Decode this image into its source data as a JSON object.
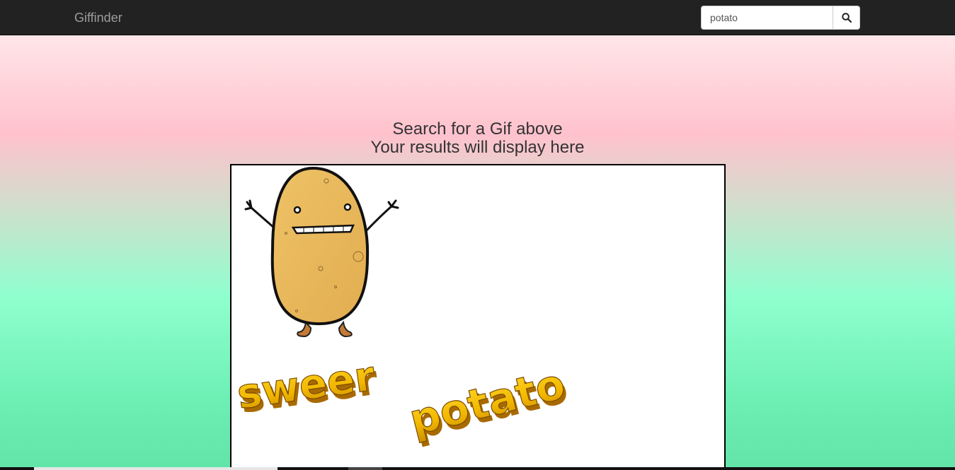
{
  "navbar": {
    "brand": "Giffinder",
    "search": {
      "value": "potato",
      "button_icon": "search-icon"
    }
  },
  "main": {
    "headline_line1": "Search for a Gif above",
    "headline_line2": "Your results will display here",
    "result_gif": {
      "text_word1": "sweer",
      "text_word2": "potato"
    }
  },
  "colors": {
    "navbar_bg": "#222222",
    "brand_text": "#9d9d9d",
    "gradient_top": "#fff3f3",
    "gradient_pink": "#ffc2cd",
    "gradient_green": "#8fffce",
    "potato_fill": "#e9bb5c",
    "word_art": "#f4c200"
  }
}
